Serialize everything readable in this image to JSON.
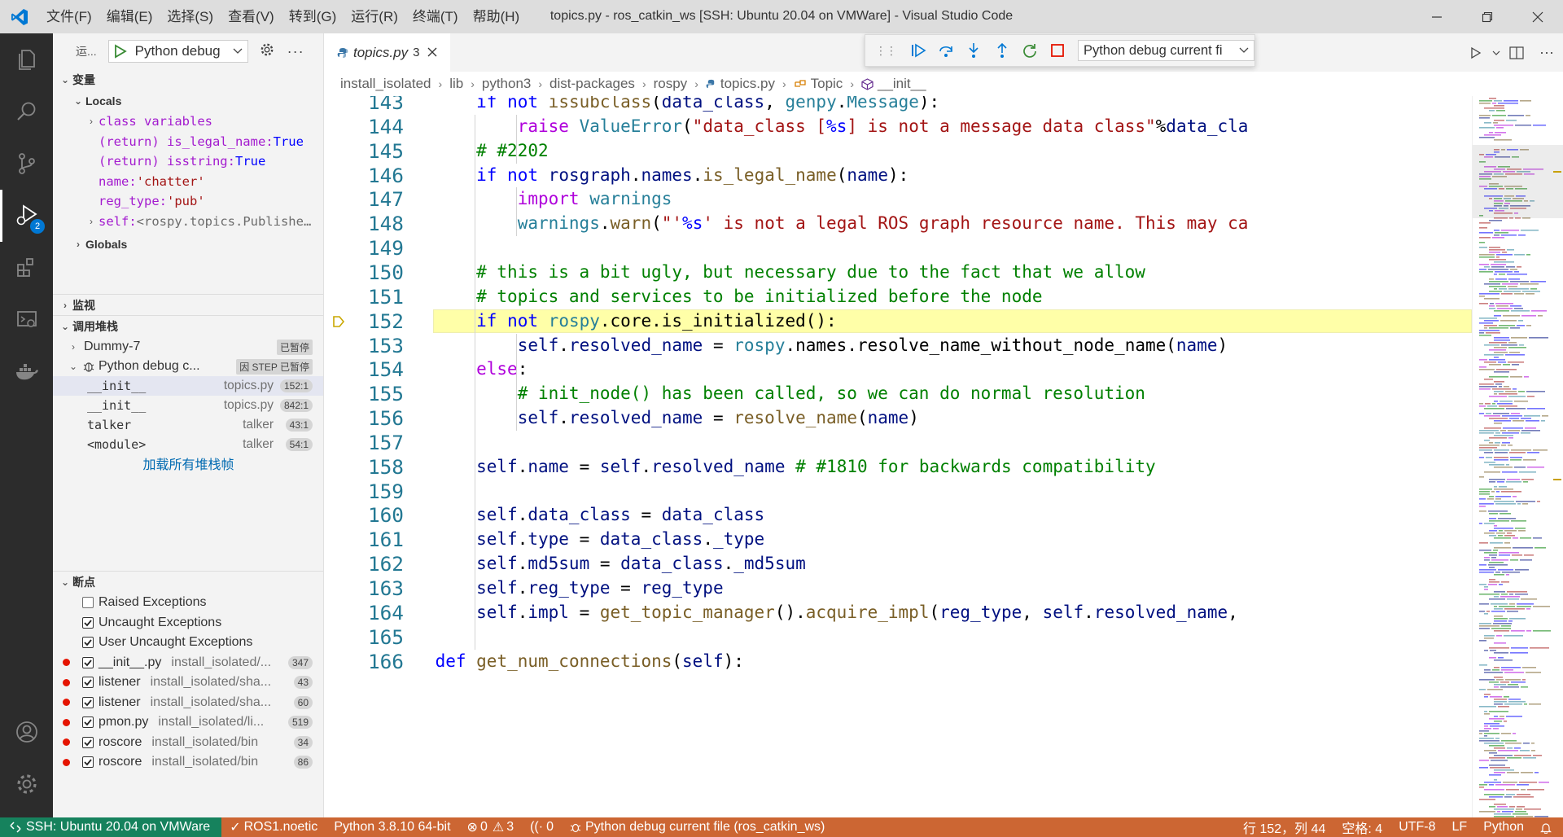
{
  "window": {
    "title": "topics.py - ros_catkin_ws [SSH: Ubuntu 20.04 on VMWare] - Visual Studio Code",
    "menu": [
      "文件(F)",
      "编辑(E)",
      "选择(S)",
      "查看(V)",
      "转到(G)",
      "运行(R)",
      "终端(T)",
      "帮助(H)"
    ]
  },
  "activity_bar": {
    "items": [
      "explorer-icon",
      "search-icon",
      "source-control-icon",
      "run-debug-icon",
      "extensions-icon",
      "remote-explorer-icon",
      "docker-icon"
    ],
    "debug_badge": "2",
    "bottom": [
      "account-icon",
      "manage-gear-icon"
    ]
  },
  "sidebar": {
    "run_label": "运...",
    "config": "Python debug",
    "variables": {
      "title": "变量",
      "locals_title": "Locals",
      "items": [
        {
          "name": "class variables",
          "value": "",
          "expandable": true
        },
        {
          "name": "(return) is_legal_name:",
          "value": "True",
          "expandable": false
        },
        {
          "name": "(return) isstring:",
          "value": "True",
          "expandable": false
        },
        {
          "name": "name:",
          "value": "'chatter'",
          "expandable": false
        },
        {
          "name": "reg_type:",
          "value": "'pub'",
          "expandable": false
        },
        {
          "name": "self:",
          "value": "<rospy.topics.Publishe…",
          "expandable": true
        }
      ],
      "globals_title": "Globals"
    },
    "watch": {
      "title": "监视"
    },
    "callstack": {
      "title": "调用堆栈",
      "threads": [
        {
          "name": "Dummy-7",
          "status": "已暂停"
        },
        {
          "name": "Python debug c...",
          "status": "因 STEP 已暂停"
        }
      ],
      "frames": [
        {
          "fn": "__init__",
          "file": "topics.py",
          "pos": "152:1"
        },
        {
          "fn": "__init__",
          "file": "topics.py",
          "pos": "842:1"
        },
        {
          "fn": "talker",
          "file": "talker",
          "pos": "43:1"
        },
        {
          "fn": "<module>",
          "file": "talker",
          "pos": "54:1"
        }
      ],
      "load_more": "加载所有堆栈帧"
    },
    "breakpoints": {
      "title": "断点",
      "items": [
        {
          "name": "Raised Exceptions",
          "path": "",
          "count": "",
          "checked": false,
          "dot": false
        },
        {
          "name": "Uncaught Exceptions",
          "path": "",
          "count": "",
          "checked": true,
          "dot": false
        },
        {
          "name": "User Uncaught Exceptions",
          "path": "",
          "count": "",
          "checked": true,
          "dot": false
        },
        {
          "name": "__init__.py",
          "path": "install_isolated/...",
          "count": "347",
          "checked": true,
          "dot": true
        },
        {
          "name": "listener",
          "path": "install_isolated/sha...",
          "count": "43",
          "checked": true,
          "dot": true
        },
        {
          "name": "listener",
          "path": "install_isolated/sha...",
          "count": "60",
          "checked": true,
          "dot": true
        },
        {
          "name": "pmon.py",
          "path": "install_isolated/li...",
          "count": "519",
          "checked": true,
          "dot": true
        },
        {
          "name": "roscore",
          "path": "install_isolated/bin",
          "count": "34",
          "checked": true,
          "dot": true
        },
        {
          "name": "roscore",
          "path": "install_isolated/bin",
          "count": "86",
          "checked": true,
          "dot": true
        }
      ]
    }
  },
  "editor": {
    "tab": {
      "name": "topics.py",
      "problems": "3"
    },
    "debug_toolbar": {
      "buttons": [
        "continue-icon",
        "step-over-icon",
        "step-into-icon",
        "step-out-icon",
        "restart-icon",
        "stop-icon"
      ],
      "config": "Python debug current fi"
    },
    "breadcrumb": [
      "install_isolated",
      "lib",
      "python3",
      "dist-packages",
      "rospy",
      "topics.py",
      "Topic",
      "__init__"
    ],
    "current_line": "152",
    "lines": [
      {
        "n": "143",
        "indent": 2,
        "tokens": [
          [
            "kw",
            "if"
          ],
          [
            "",
            "&nbsp;"
          ],
          [
            "kw",
            "not"
          ],
          [
            "",
            "&nbsp;"
          ],
          [
            "fn",
            "issubclass"
          ],
          [
            "",
            "("
          ],
          [
            "var",
            "data_class"
          ],
          [
            "",
            ",&nbsp;"
          ],
          [
            "cls",
            "genpy"
          ],
          [
            "",
            "."
          ],
          [
            "cls",
            "Message"
          ],
          [
            "",
            "):"
          ]
        ]
      },
      {
        "n": "144",
        "indent": 3,
        "tokens": [
          [
            "ctl",
            "raise"
          ],
          [
            "",
            "&nbsp;"
          ],
          [
            "cls",
            "ValueError"
          ],
          [
            "",
            "("
          ],
          [
            "str",
            "\"data_class ["
          ],
          [
            "esc",
            "%s"
          ],
          [
            "str",
            "] is not a message data class\""
          ],
          [
            "",
            "%"
          ],
          [
            "var",
            "data_cla"
          ]
        ]
      },
      {
        "n": "145",
        "indent": 2,
        "tokens": [
          [
            "com",
            "# #2202"
          ]
        ]
      },
      {
        "n": "146",
        "indent": 2,
        "tokens": [
          [
            "kw",
            "if"
          ],
          [
            "",
            "&nbsp;"
          ],
          [
            "kw",
            "not"
          ],
          [
            "",
            "&nbsp;"
          ],
          [
            "var",
            "rosgraph"
          ],
          [
            "",
            "."
          ],
          [
            "var",
            "names"
          ],
          [
            "",
            "."
          ],
          [
            "fn",
            "is_legal_name"
          ],
          [
            "",
            "("
          ],
          [
            "var",
            "name"
          ],
          [
            "",
            "):"
          ]
        ]
      },
      {
        "n": "147",
        "indent": 3,
        "tokens": [
          [
            "ctl",
            "import"
          ],
          [
            "",
            "&nbsp;"
          ],
          [
            "cls",
            "warnings"
          ]
        ]
      },
      {
        "n": "148",
        "indent": 3,
        "tokens": [
          [
            "cls",
            "warnings"
          ],
          [
            "",
            "."
          ],
          [
            "fn",
            "warn"
          ],
          [
            "",
            "("
          ],
          [
            "str",
            "\"'"
          ],
          [
            "esc",
            "%s"
          ],
          [
            "str",
            "' is not a legal ROS graph resource name. This may ca"
          ]
        ]
      },
      {
        "n": "149",
        "indent": 0,
        "tokens": []
      },
      {
        "n": "150",
        "indent": 2,
        "tokens": [
          [
            "com",
            "# this is a bit ugly, but necessary due to the fact that we allow"
          ]
        ]
      },
      {
        "n": "151",
        "indent": 2,
        "tokens": [
          [
            "com",
            "# topics and services to be initialized before the node"
          ]
        ]
      },
      {
        "n": "152",
        "indent": 2,
        "tokens": [
          [
            "kw",
            "if"
          ],
          [
            "",
            "&nbsp;"
          ],
          [
            "kw",
            "not"
          ],
          [
            "",
            "&nbsp;"
          ],
          [
            "cls",
            "rospy"
          ],
          [
            "",
            ".core.is_initialized():"
          ]
        ]
      },
      {
        "n": "153",
        "indent": 3,
        "tokens": [
          [
            "var",
            "self"
          ],
          [
            "",
            "."
          ],
          [
            "var",
            "resolved_name"
          ],
          [
            "",
            "&nbsp;=&nbsp;"
          ],
          [
            "cls",
            "rospy"
          ],
          [
            "",
            ".names.resolve_name_without_node_name("
          ],
          [
            "var",
            "name"
          ],
          [
            "",
            ")"
          ]
        ]
      },
      {
        "n": "154",
        "indent": 2,
        "tokens": [
          [
            "ctl",
            "else"
          ],
          [
            "",
            ":"
          ]
        ]
      },
      {
        "n": "155",
        "indent": 3,
        "tokens": [
          [
            "com",
            "# init_node() has been called, so we can do normal resolution"
          ]
        ]
      },
      {
        "n": "156",
        "indent": 3,
        "tokens": [
          [
            "var",
            "self"
          ],
          [
            "",
            "."
          ],
          [
            "var",
            "resolved_name"
          ],
          [
            "",
            "&nbsp;=&nbsp;"
          ],
          [
            "fn",
            "resolve_name"
          ],
          [
            "",
            "("
          ],
          [
            "var",
            "name"
          ],
          [
            "",
            ")"
          ]
        ]
      },
      {
        "n": "157",
        "indent": 0,
        "tokens": []
      },
      {
        "n": "158",
        "indent": 2,
        "tokens": [
          [
            "var",
            "self"
          ],
          [
            "",
            "."
          ],
          [
            "var",
            "name"
          ],
          [
            "",
            "&nbsp;=&nbsp;"
          ],
          [
            "var",
            "self"
          ],
          [
            "",
            "."
          ],
          [
            "var",
            "resolved_name"
          ],
          [
            "",
            "&nbsp;"
          ],
          [
            "com",
            "# #1810 for backwards compatibility"
          ]
        ]
      },
      {
        "n": "159",
        "indent": 0,
        "tokens": []
      },
      {
        "n": "160",
        "indent": 2,
        "tokens": [
          [
            "var",
            "self"
          ],
          [
            "",
            "."
          ],
          [
            "var",
            "data_class"
          ],
          [
            "",
            "&nbsp;=&nbsp;"
          ],
          [
            "var",
            "data_class"
          ]
        ]
      },
      {
        "n": "161",
        "indent": 2,
        "tokens": [
          [
            "var",
            "self"
          ],
          [
            "",
            "."
          ],
          [
            "var",
            "type"
          ],
          [
            "",
            "&nbsp;=&nbsp;"
          ],
          [
            "var",
            "data_class"
          ],
          [
            "",
            "."
          ],
          [
            "var",
            "_type"
          ]
        ]
      },
      {
        "n": "162",
        "indent": 2,
        "tokens": [
          [
            "var",
            "self"
          ],
          [
            "",
            "."
          ],
          [
            "var",
            "md5sum"
          ],
          [
            "",
            "&nbsp;=&nbsp;"
          ],
          [
            "var",
            "data_class"
          ],
          [
            "",
            "."
          ],
          [
            "var",
            "_md5sum"
          ]
        ]
      },
      {
        "n": "163",
        "indent": 2,
        "tokens": [
          [
            "var",
            "self"
          ],
          [
            "",
            "."
          ],
          [
            "var",
            "reg_type"
          ],
          [
            "",
            "&nbsp;=&nbsp;"
          ],
          [
            "var",
            "reg_type"
          ]
        ]
      },
      {
        "n": "164",
        "indent": 2,
        "tokens": [
          [
            "var",
            "self"
          ],
          [
            "",
            "."
          ],
          [
            "var",
            "impl"
          ],
          [
            "",
            "&nbsp;=&nbsp;"
          ],
          [
            "fn",
            "get_topic_manager"
          ],
          [
            "",
            "()."
          ],
          [
            "fn",
            "acquire_impl"
          ],
          [
            "",
            "("
          ],
          [
            "var",
            "reg_type"
          ],
          [
            "",
            ",&nbsp;"
          ],
          [
            "var",
            "self"
          ],
          [
            "",
            "."
          ],
          [
            "var",
            "resolved_name"
          ],
          [
            "",
            ","
          ]
        ]
      },
      {
        "n": "165",
        "indent": 0,
        "tokens": []
      },
      {
        "n": "166",
        "indent": 1,
        "tokens": [
          [
            "def",
            "def"
          ],
          [
            "",
            "&nbsp;"
          ],
          [
            "fn",
            "get_num_connections"
          ],
          [
            "",
            "("
          ],
          [
            "var",
            "self"
          ],
          [
            "",
            "):"
          ]
        ]
      }
    ]
  },
  "statusbar": {
    "remote": "SSH: Ubuntu 20.04 on VMWare",
    "ros": "ROS1.noetic",
    "python": "Python 3.8.10 64-bit",
    "errors": "0",
    "warnings": "3",
    "ports": "0",
    "debug": "Python debug current file (ros_catkin_ws)",
    "cursor": "行 152，列 44",
    "spaces": "空格: 4",
    "encoding": "UTF-8",
    "eol": "LF",
    "language": "Python"
  },
  "colors": {
    "statusbar_debug": "#cc6633",
    "remote": "#16825d",
    "current_line": "#ffffa8",
    "breakpoint": "#e51400",
    "badge": "#0078d4"
  }
}
